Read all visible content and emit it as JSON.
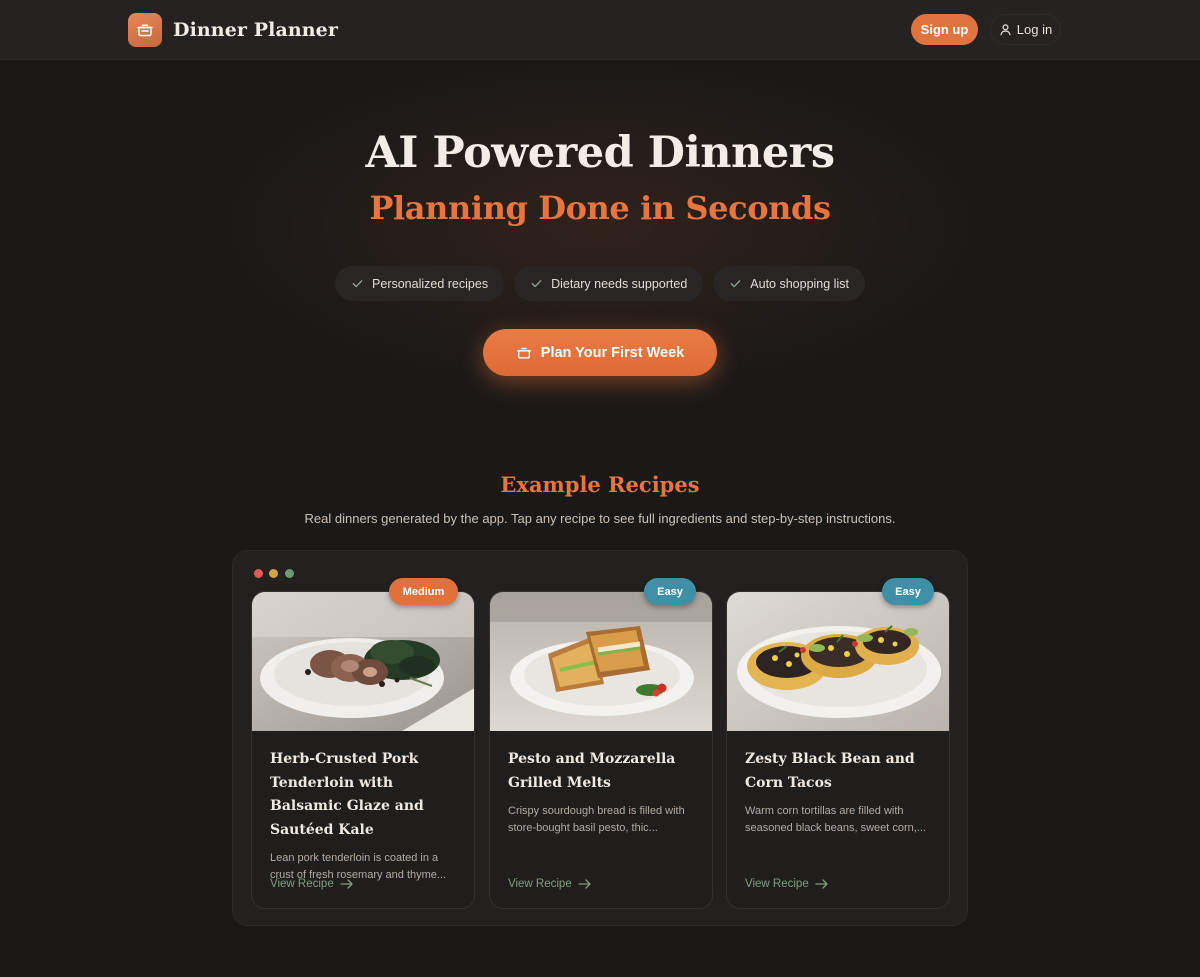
{
  "header": {
    "brand_name": "Dinner Planner",
    "signup_label": "Sign up",
    "login_label": "Log in"
  },
  "hero": {
    "title": "AI Powered Dinners",
    "subtitle": "Planning Done in Seconds",
    "features": [
      "Personalized recipes",
      "Dietary needs supported",
      "Auto shopping list"
    ],
    "cta_label": "Plan Your First Week"
  },
  "examples": {
    "title": "Example Recipes",
    "subtitle": "Real dinners generated by the app. Tap any recipe to see full ingredients and step-by-step instructions.",
    "recipes": [
      {
        "badge": "Medium",
        "badge_color": "#e0703c",
        "title": "Herb-Crusted Pork Tenderloin with Balsamic Glaze and Sautéed Kale",
        "description": "Lean pork tenderloin is coated in a crust of fresh rosemary and thyme...",
        "link": "View Recipe"
      },
      {
        "badge": "Easy",
        "badge_color": "#3f8fa6",
        "title": "Pesto and Mozzarella Grilled Melts",
        "description": "Crispy sourdough bread is filled with store-bought basil pesto, thic...",
        "link": "View Recipe"
      },
      {
        "badge": "Easy",
        "badge_color": "#3f8fa6",
        "title": "Zesty Black Bean and Corn Tacos",
        "description": "Warm corn tortillas are filled with seasoned black beans, sweet corn,...",
        "link": "View Recipe"
      }
    ]
  },
  "colors": {
    "background": "#1b1918",
    "accent": "#e8743e",
    "link_green": "#7fa07d",
    "window_dots": [
      "#e2595a",
      "#d9a440",
      "#6f9a72"
    ]
  }
}
